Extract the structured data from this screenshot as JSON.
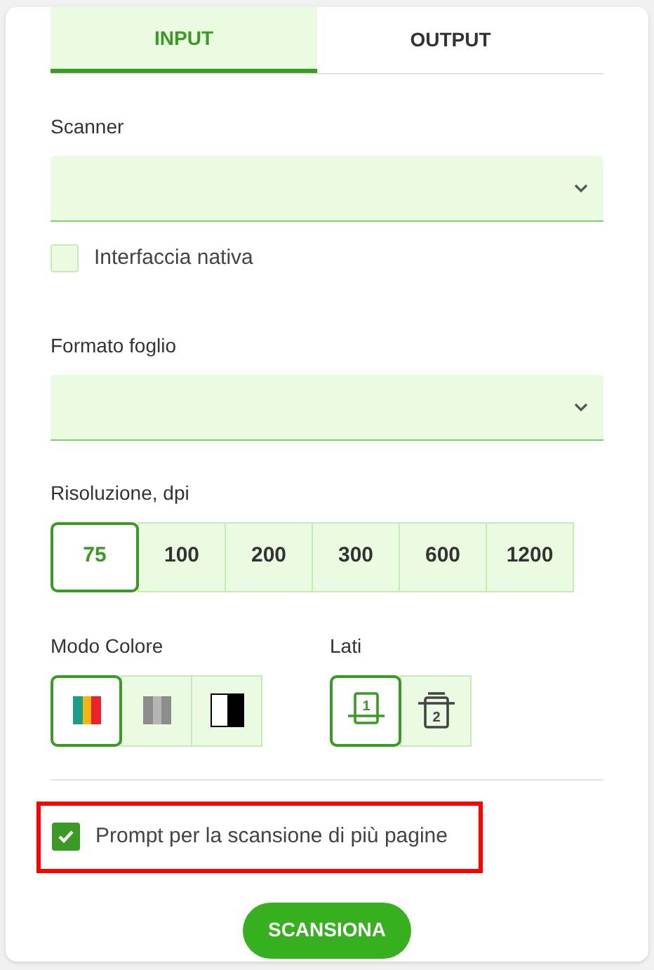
{
  "tabs": [
    {
      "label": "INPUT",
      "selected": true
    },
    {
      "label": "OUTPUT",
      "selected": false
    }
  ],
  "scanner": {
    "label": "Scanner"
  },
  "native_interface": {
    "label": "Interfaccia nativa",
    "checked": false
  },
  "paper_format": {
    "label": "Formato foglio"
  },
  "resolution": {
    "label": "Risoluzione, dpi",
    "options": [
      {
        "label": "75",
        "selected": true
      },
      {
        "label": "100",
        "selected": false
      },
      {
        "label": "200",
        "selected": false
      },
      {
        "label": "300",
        "selected": false
      },
      {
        "label": "600",
        "selected": false
      },
      {
        "label": "1200",
        "selected": false
      }
    ]
  },
  "color_mode": {
    "label": "Modo Colore",
    "options": [
      {
        "kind": "color",
        "selected": true
      },
      {
        "kind": "grayscale",
        "selected": false
      },
      {
        "kind": "blackwhite",
        "selected": false
      }
    ]
  },
  "sides": {
    "label": "Lati",
    "options": [
      {
        "kind": "single",
        "text": "1",
        "selected": true
      },
      {
        "kind": "double",
        "text": "2",
        "selected": false
      }
    ]
  },
  "multipage": {
    "label": "Prompt per la scansione di più pagine",
    "checked": true,
    "highlighted": true
  },
  "scan_button": "SCANSIONA"
}
